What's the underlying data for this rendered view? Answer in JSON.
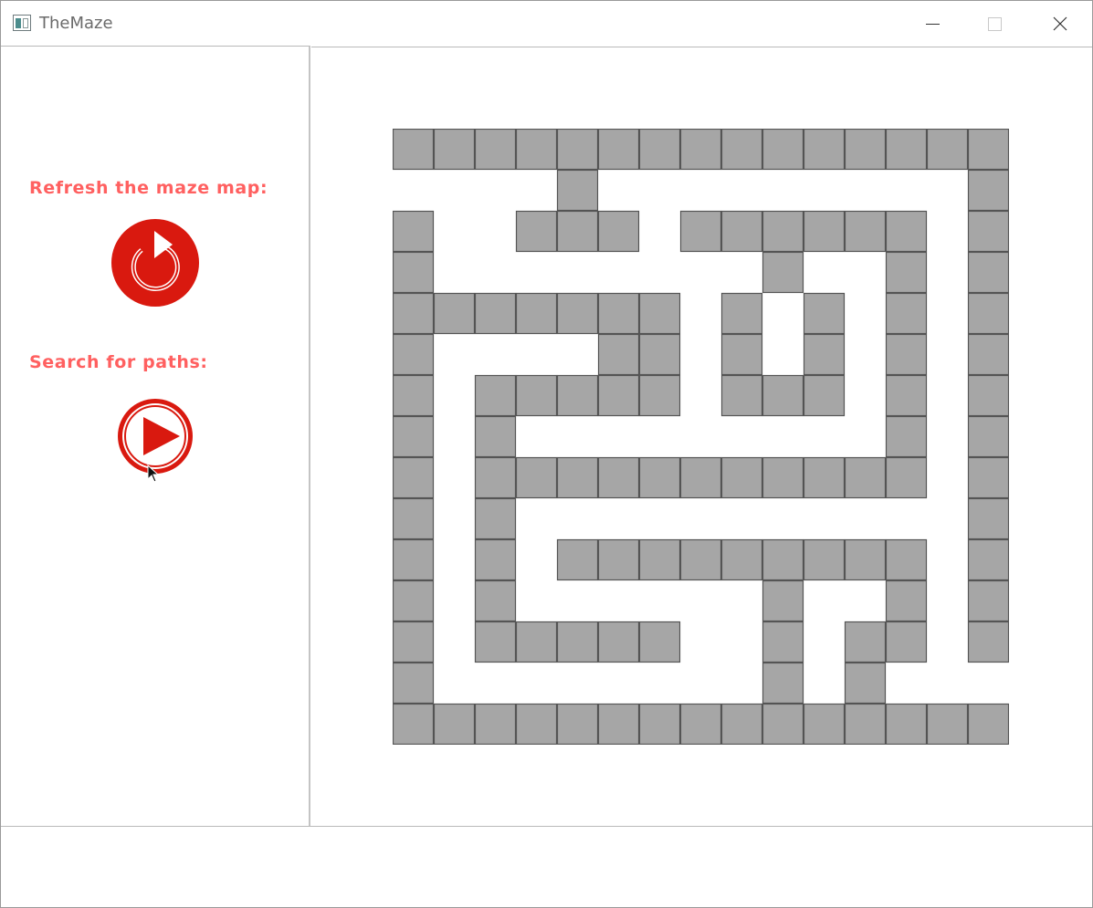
{
  "window": {
    "title": "TheMaze",
    "icon": "app-window-icon",
    "controls": [
      "minimize-icon",
      "maximize-icon",
      "close-icon"
    ]
  },
  "sidebar": {
    "refresh_label": "Refresh the maze map:",
    "refresh_icon": "refresh-icon",
    "search_label": "Search for paths:",
    "search_icon": "play-icon",
    "accent_color": "#ff6060",
    "button_color": "#d9190f"
  },
  "maze": {
    "rows": 15,
    "cols": 15,
    "wall_color": "#a6a6a6",
    "wall_border_color": "#555555",
    "grid": [
      "111111111111111",
      "000010000000001",
      "100111011111101",
      "100000000100101",
      "111111101010101",
      "100001101010101",
      "101111101110101",
      "101000000000101",
      "101111111111101",
      "101000000000001",
      "101011111111101",
      "101000000100101",
      "101111100101101",
      "100000000101000",
      "111111111111111"
    ]
  }
}
